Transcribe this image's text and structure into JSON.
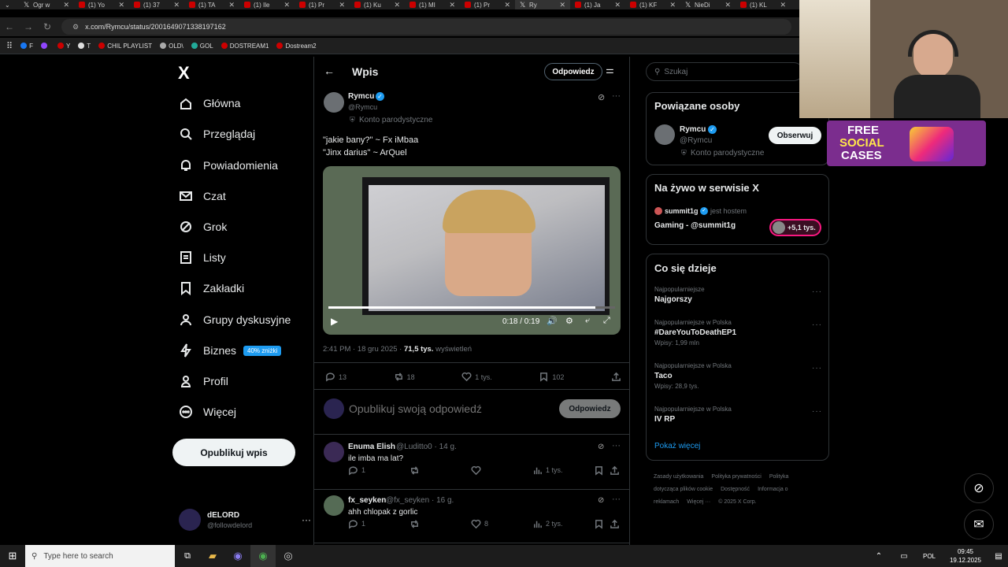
{
  "browser": {
    "tabs": [
      {
        "label": "Ogr w",
        "icon": "x"
      },
      {
        "label": "(1) Yo",
        "icon": "yt"
      },
      {
        "label": "(1) 37",
        "icon": "yt"
      },
      {
        "label": "(1) TA",
        "icon": "yt"
      },
      {
        "label": "(1) Ile",
        "icon": "yt"
      },
      {
        "label": "(1) Pr",
        "icon": "yt"
      },
      {
        "label": "(1) Ku",
        "icon": "yt"
      },
      {
        "label": "(1) MI",
        "icon": "yt"
      },
      {
        "label": "(1) Pr",
        "icon": "yt"
      },
      {
        "label": "Ry",
        "icon": "x"
      },
      {
        "label": "(1) Ja",
        "icon": "yt"
      },
      {
        "label": "(1) KF",
        "icon": "yt"
      },
      {
        "label": "NieDi",
        "icon": "x"
      },
      {
        "label": "(1) KL",
        "icon": "yt"
      }
    ],
    "url": "x.com/Rymcu/status/2001649071338197162",
    "bookmarks": [
      "F",
      "",
      "Y",
      "T",
      "CHIL PLAYLIST",
      "OLD\\",
      "GOL",
      "DOSTREAM1",
      "Dostream2"
    ]
  },
  "leftnav": {
    "logo": "X",
    "items": [
      "Główna",
      "Przeglądaj",
      "Powiadomienia",
      "Czat",
      "Grok",
      "Listy",
      "Zakładki",
      "Grupy dyskusyjne",
      "Biznes",
      "Profil",
      "Więcej"
    ],
    "promo_badge": "40% zniżki",
    "post_button": "Opublikuj wpis",
    "account": {
      "name": "dELORD",
      "handle": "@followdelord",
      "more": "···"
    }
  },
  "post": {
    "header_title": "Wpis",
    "reply_button": "Odpowiedz",
    "author_name": "Rymcu",
    "author_handle": "@Rymcu",
    "parody_label": "Konto parodystyczne",
    "text_line1": "\"jakie bany?\" ~ Fx iMbaa",
    "text_line2": "\"Jinx darius\" ~ ArQuel",
    "video_time": "0:18 / 0:19",
    "video_progress": 0.93,
    "timestamp": "2:41 PM · 18 gru 2025 · ",
    "views_count": "71,5 tys.",
    "views_label": " wyświetleń",
    "stats": {
      "replies": "13",
      "reposts": "18",
      "likes": "1 tys.",
      "bookmarks": "102"
    },
    "reply_placeholder": "Opublikuj swoją odpowiedź",
    "reply_submit": "Odpowiedz"
  },
  "replies": [
    {
      "name": "Enuma Elish",
      "meta": "@Luditto0 · 14 g.",
      "text": "ile imba ma lat?",
      "replies": "1",
      "likes": "",
      "views": "1 tys."
    },
    {
      "name": "fx_seyken",
      "meta": "@fx_seyken · 16 g.",
      "text": "ahh chlopak z gorlic",
      "replies": "1",
      "likes": "8",
      "views": "2 tys."
    }
  ],
  "right": {
    "search_placeholder": "Szukaj",
    "related_title": "Powiązane osoby",
    "related": {
      "name": "Rymcu",
      "handle": "@Rymcu",
      "parody": "Konto parodystyczne",
      "follow": "Obserwuj"
    },
    "live_title": "Na żywo w serwisie X",
    "live": {
      "host": "summit1g",
      "host_label": "jest hostem",
      "title": "Gaming - @summit1g",
      "count": "+5,1 tys."
    },
    "trends_title": "Co się dzieje",
    "trends": [
      {
        "context": "Najpopularniejsze",
        "name": "Najgorszy",
        "posts": ""
      },
      {
        "context": "Najpopularniejsze w Polska",
        "name": "#DareYouToDeathEP1",
        "posts": "Wpisy: 1,99 mln"
      },
      {
        "context": "Najpopularniejsze w Polska",
        "name": "Taco",
        "posts": "Wpisy: 28,9 tys."
      },
      {
        "context": "Najpopularniejsze w Polska",
        "name": "IV RP",
        "posts": ""
      }
    ],
    "show_more": "Pokaż więcej",
    "footer": [
      "Zasady użytkowania",
      "Polityka prywatności",
      "Polityka dotycząca plików cookie",
      "Dostępność",
      "Informacja o reklamach",
      "Więcej ···",
      "© 2025 X Corp."
    ]
  },
  "overlay": {
    "promo_text1": "FREE",
    "promo_text2": "SOCIAL",
    "promo_text3": "CASES"
  },
  "taskbar": {
    "search_placeholder": "Type here to search",
    "lang": "POL",
    "time": "09:45",
    "date": "19.12.2025"
  },
  "colors": {
    "accent": "#1d9bf0",
    "bg": "#000000",
    "border": "#2f3336",
    "muted": "#71767b"
  }
}
